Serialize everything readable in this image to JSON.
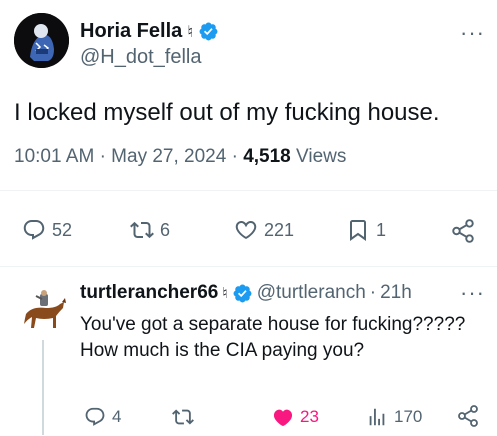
{
  "tweet": {
    "author_name": "Horia Fella",
    "author_badge": "♮",
    "author_handle": "@H_dot_fella",
    "text": "I locked myself out of my fucking house.",
    "time": "10:01 AM",
    "date": "May 27, 2024",
    "views_count": "4,518",
    "views_label": "Views",
    "replies": "52",
    "retweets": "6",
    "likes": "221",
    "bookmarks": "1",
    "more_label": "···"
  },
  "reply": {
    "author_name": "turtlerancher66",
    "author_badge": "♮",
    "author_handle": "@turtleranch",
    "age": "21h",
    "text": "You've got a separate house for fucking????? How much is the CIA paying you?",
    "replies": "4",
    "retweets": "",
    "likes": "23",
    "views": "170",
    "more_label": "···",
    "like_color": "#f91880"
  },
  "colors": {
    "verified": "#1d9bf0",
    "muted": "#536471",
    "text": "#0f1419"
  }
}
